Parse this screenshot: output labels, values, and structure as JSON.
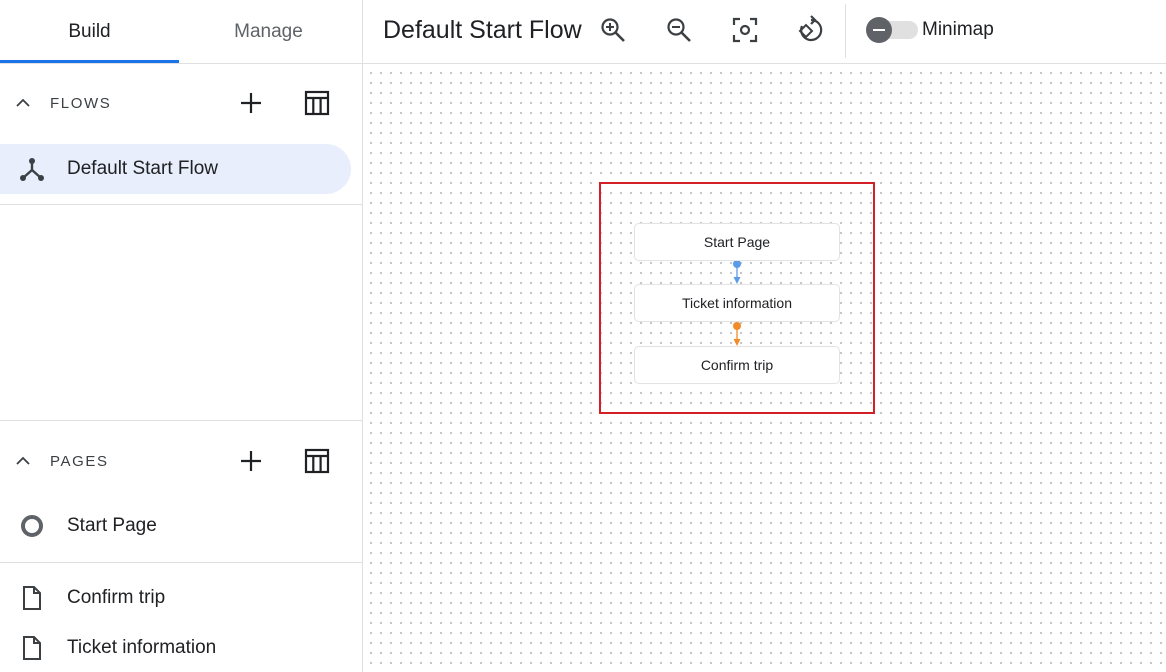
{
  "sidebar": {
    "tabs": [
      {
        "label": "Build",
        "active": true
      },
      {
        "label": "Manage",
        "active": false
      }
    ],
    "flows": {
      "title": "FLOWS",
      "items": [
        {
          "label": "Default Start Flow",
          "icon": "flow-icon",
          "selected": true
        }
      ]
    },
    "pages": {
      "title": "PAGES",
      "items": [
        {
          "label": "Start Page",
          "icon": "start-page-circle-icon"
        },
        {
          "label": "Confirm trip",
          "icon": "page-file-icon"
        },
        {
          "label": "Ticket information",
          "icon": "page-file-icon"
        }
      ]
    }
  },
  "toolbar": {
    "title": "Default Start Flow",
    "minimap_label": "Minimap",
    "minimap_enabled": false,
    "buttons": [
      "zoom-in-icon",
      "zoom-out-icon",
      "center-focus-icon",
      "reset-layout-icon"
    ]
  },
  "canvas": {
    "nodes": [
      {
        "label": "Start Page"
      },
      {
        "label": "Ticket information"
      },
      {
        "label": "Confirm trip"
      }
    ],
    "edge_colors": [
      "#5b9bea",
      "#f28c28"
    ],
    "highlight_color": "#d32027"
  },
  "colors": {
    "accent": "#1a73e8",
    "selected_bg": "#e8eefb"
  }
}
